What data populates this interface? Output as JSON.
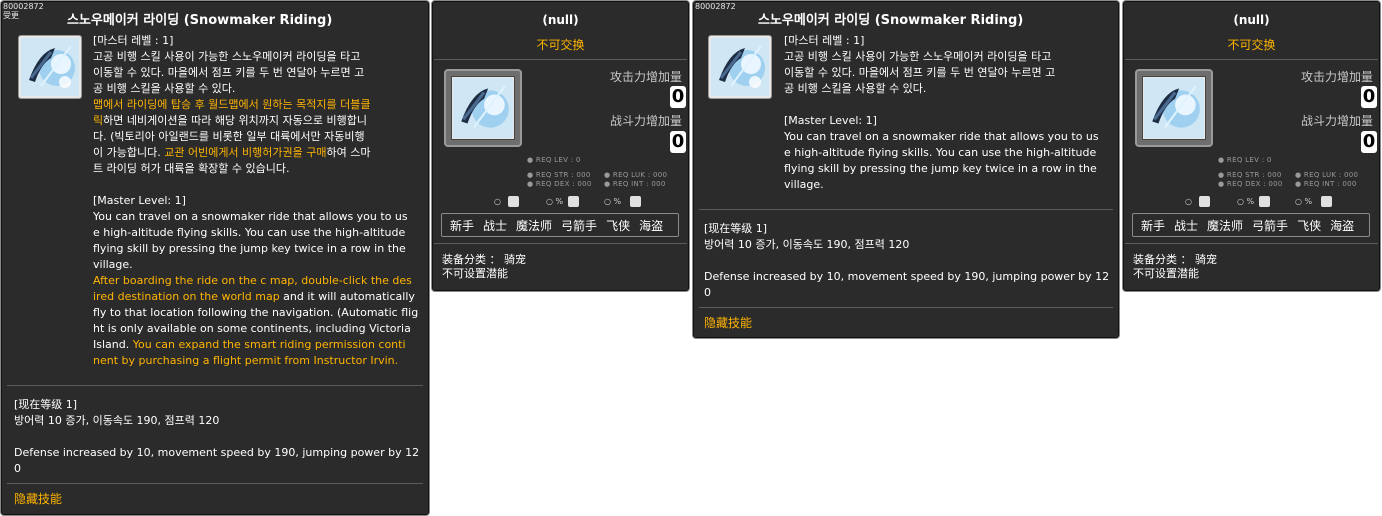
{
  "skill_left": {
    "id": "80002872",
    "id_sub": "受更",
    "title": "스노우메이커 라이딩 (Snowmaker Riding)",
    "master_level_kr": "[마스터 레벨 : 1]",
    "desc_kr_1": "고공 비행 스킬 사용이 가능한 스노우메이커 라이딩을 타고",
    "desc_kr_2": "이동할 수 있다. 마을에서 점프 키를 두 번 연달아 누르면 고",
    "desc_kr_3": "공 비행 스킬을 사용할 수 있다.",
    "hl_kr_1": "맵에서 라이딩에 탑승 후 월드맵에서 원하는 목적지를 더블클",
    "hl_kr_2a": "릭",
    "desc_kr_4b": "하면 네비게이션을 따라 해당 위치까지 자동으로 비행합니",
    "desc_kr_5": "다. (빅토리아 아일랜드를 비롯한 일부 대륙에서만 자동비행",
    "desc_kr_6a": "이 가능합니다. ",
    "hl_kr_6b": "교관 어빈에게서 비행허가권을 구매",
    "desc_kr_6c": "하여 스마",
    "desc_kr_7": "트 라이딩 허가 대륙을 확장할 수 있습니다.",
    "master_level_en": "[Master Level: 1]",
    "desc_en_1": "You can travel on a snowmaker ride that allows you to us",
    "desc_en_2": "e high-altitude flying skills. You can use the high-altitude",
    "desc_en_3": "flying skill by pressing the jump key twice in a row in the",
    "desc_en_4": "village.",
    "hl_en_1": "After boarding the ride on the c map, double-click the des",
    "hl_en_2a": "ired destination on the world map",
    "desc_en_5b": " and it will automatically",
    "desc_en_6": "fly to that location following the navigation. (Automatic flig",
    "desc_en_7": "ht is only available on some continents, including Victoria",
    "desc_en_8a": "Island. ",
    "hl_en_8b": "You can expand the smart riding permission conti",
    "hl_en_9": "nent by purchasing a flight permit from Instructor Irvin.",
    "current_level": "[现在等级 1]",
    "effect_kr": "방어력 10 증가, 이동속도 190, 점프력 120",
    "effect_en_1": "Defense increased by 10, movement speed by 190, jumping power by 12",
    "effect_en_2": "0",
    "hidden": "隐藏技能"
  },
  "equip_left": {
    "title": "(null)",
    "trade": "不可交换",
    "attack_label": "攻击力增加量",
    "attack_value": "0",
    "power_label": "战斗力增加量",
    "power_value": "0",
    "req_lev": "● REQ LEV :      0",
    "req_str": "● REQ STR : 000",
    "req_luk": "● REQ LUK : 000",
    "req_dex": "● REQ DEX : 000",
    "req_int": "● REQ INT : 000",
    "mini_1": "○",
    "mini_2": "○ %",
    "mini_3": "○ %",
    "jobs": [
      "新手",
      "战士",
      "魔法师",
      "弓箭手",
      "飞侠",
      "海盗"
    ],
    "category": "装备分类 ： 骑宠",
    "potential": "不可设置潜能"
  },
  "skill_right": {
    "id": "80002872",
    "title": "스노우메이커 라이딩 (Snowmaker Riding)",
    "master_level_kr": "[마스터 레벨 : 1]",
    "desc_kr_1": "고공 비행 스킬 사용이 가능한 스노우메이커 라이딩을 타고",
    "desc_kr_2": "이동할 수 있다. 마을에서 점프 키를 두 번 연달아 누르면 고",
    "desc_kr_3": "공 비행 스킬을 사용할 수 있다.",
    "master_level_en": "[Master Level: 1]",
    "desc_en_1": "You can travel on a snowmaker ride that allows you to us",
    "desc_en_2": "e high-altitude flying skills. You can use the high-altitude",
    "desc_en_3": "flying skill by pressing the jump key twice in a row in the",
    "desc_en_4": "village.",
    "current_level": "[现在等级 1]",
    "effect_kr": "방어력 10 증가, 이동속도 190, 점프력 120",
    "effect_en_1": "Defense increased by 10, movement speed by 190, jumping power by 12",
    "effect_en_2": "0",
    "hidden": "隐藏技能"
  },
  "equip_right": {
    "title": "(null)",
    "trade": "不可交换",
    "attack_label": "攻击力增加量",
    "attack_value": "0",
    "power_label": "战斗力增加量",
    "power_value": "0",
    "req_lev": "● REQ LEV :      0",
    "req_str": "● REQ STR : 000",
    "req_luk": "● REQ LUK : 000",
    "req_dex": "● REQ DEX : 000",
    "req_int": "● REQ INT : 000",
    "mini_1": "○",
    "mini_2": "○ %",
    "mini_3": "○ %",
    "jobs": [
      "新手",
      "战士",
      "魔法师",
      "弓箭手",
      "飞侠",
      "海盗"
    ],
    "category": "装备分类 ： 骑宠",
    "potential": "不可设置潜能"
  },
  "colors": {
    "panel_bg": "#2b2b2b",
    "highlight": "#ffb400",
    "border": "#8a8a8a"
  },
  "icons": [
    "snowmaker-riding-icon",
    "stat-icon"
  ]
}
